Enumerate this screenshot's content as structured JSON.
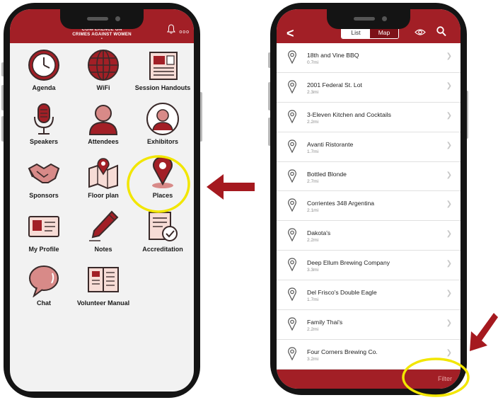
{
  "left": {
    "title_line1": "CONFERENCE ON",
    "title_line2": "CRIMES AGAINST WOMEN",
    "title_dot": "•",
    "more": "ooo",
    "tiles": [
      {
        "label": "Agenda",
        "icon": "clock-icon"
      },
      {
        "label": "WiFi",
        "icon": "globe-icon"
      },
      {
        "label": "Session Handouts",
        "icon": "newspaper-icon"
      },
      {
        "label": "Speakers",
        "icon": "microphone-icon"
      },
      {
        "label": "Attendees",
        "icon": "person-icon"
      },
      {
        "label": "Exhibitors",
        "icon": "person-circle-icon"
      },
      {
        "label": "Sponsors",
        "icon": "handshake-icon"
      },
      {
        "label": "Floor plan",
        "icon": "map-icon"
      },
      {
        "label": "Places",
        "icon": "location-pin-icon"
      },
      {
        "label": "My Profile",
        "icon": "id-card-icon"
      },
      {
        "label": "Notes",
        "icon": "pen-icon"
      },
      {
        "label": "Accreditation",
        "icon": "certificate-icon"
      },
      {
        "label": "Chat",
        "icon": "chat-bubble-icon"
      },
      {
        "label": "Volunteer Manual",
        "icon": "book-icon"
      }
    ]
  },
  "right": {
    "back": "<",
    "tab_list": "List",
    "tab_map": "Map",
    "filter": "Filter",
    "places": [
      {
        "name": "18th and Vine BBQ",
        "dist": "0.7mi"
      },
      {
        "name": "2001 Federal St. Lot",
        "dist": "2.3mi"
      },
      {
        "name": "3-Eleven Kitchen and Cocktails",
        "dist": "2.2mi"
      },
      {
        "name": "Avanti Ristorante",
        "dist": "1.7mi"
      },
      {
        "name": "Bottled Blonde",
        "dist": "2.7mi"
      },
      {
        "name": "Corrientes 348 Argentina",
        "dist": "2.1mi"
      },
      {
        "name": "Dakota's",
        "dist": "2.2mi"
      },
      {
        "name": "Deep Ellum Brewing Company",
        "dist": "3.3mi"
      },
      {
        "name": "Del Frisco's Double Eagle",
        "dist": "1.7mi"
      },
      {
        "name": "Family Thai's",
        "dist": "2.2mi"
      },
      {
        "name": "Four Corners Brewing Co.",
        "dist": "3.2mi"
      }
    ]
  },
  "colors": {
    "brand": "#a21f26",
    "highlight": "#f2e600",
    "arrow": "#a5191f"
  }
}
